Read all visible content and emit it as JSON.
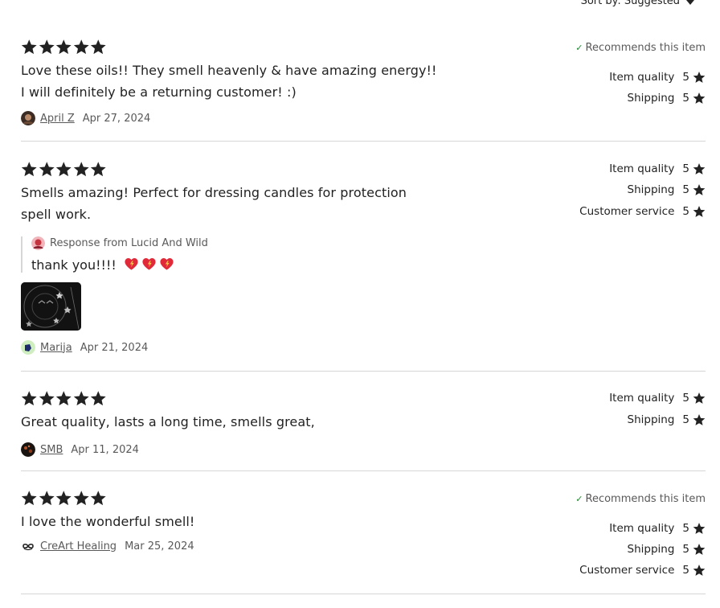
{
  "sort": {
    "label": "Sort by: Suggested"
  },
  "colors": {
    "star": "#222222",
    "check": "#258635",
    "divider": "#d6d6d6",
    "muted": "#595959"
  },
  "reviews": [
    {
      "stars": 5,
      "text": "Love these oils!! They smell heavenly & have amazing energy!! I will definitely be a returning customer! :)",
      "reviewer": "April Z",
      "date": "Apr 27, 2024",
      "recommends": "Recommends this item",
      "ratings": [
        {
          "label": "Item quality",
          "value": "5"
        },
        {
          "label": "Shipping",
          "value": "5"
        }
      ]
    },
    {
      "stars": 5,
      "text": "Smells amazing! Perfect for dressing candles for protection spell work.",
      "response": {
        "from": "Response from Lucid And Wild",
        "text": "thank you!!!!"
      },
      "reviewer": "Marija",
      "date": "Apr 21, 2024",
      "ratings": [
        {
          "label": "Item quality",
          "value": "5"
        },
        {
          "label": "Shipping",
          "value": "5"
        },
        {
          "label": "Customer service",
          "value": "5"
        }
      ]
    },
    {
      "stars": 5,
      "text": "Great quality, lasts a long time, smells great,",
      "reviewer": "SMB",
      "date": "Apr 11, 2024",
      "ratings": [
        {
          "label": "Item quality",
          "value": "5"
        },
        {
          "label": "Shipping",
          "value": "5"
        }
      ]
    },
    {
      "stars": 5,
      "text": "I love the wonderful smell!",
      "reviewer": "CreArt Healing",
      "date": "Mar 25, 2024",
      "recommends": "Recommends this item",
      "ratings": [
        {
          "label": "Item quality",
          "value": "5"
        },
        {
          "label": "Shipping",
          "value": "5"
        },
        {
          "label": "Customer service",
          "value": "5"
        }
      ]
    }
  ]
}
